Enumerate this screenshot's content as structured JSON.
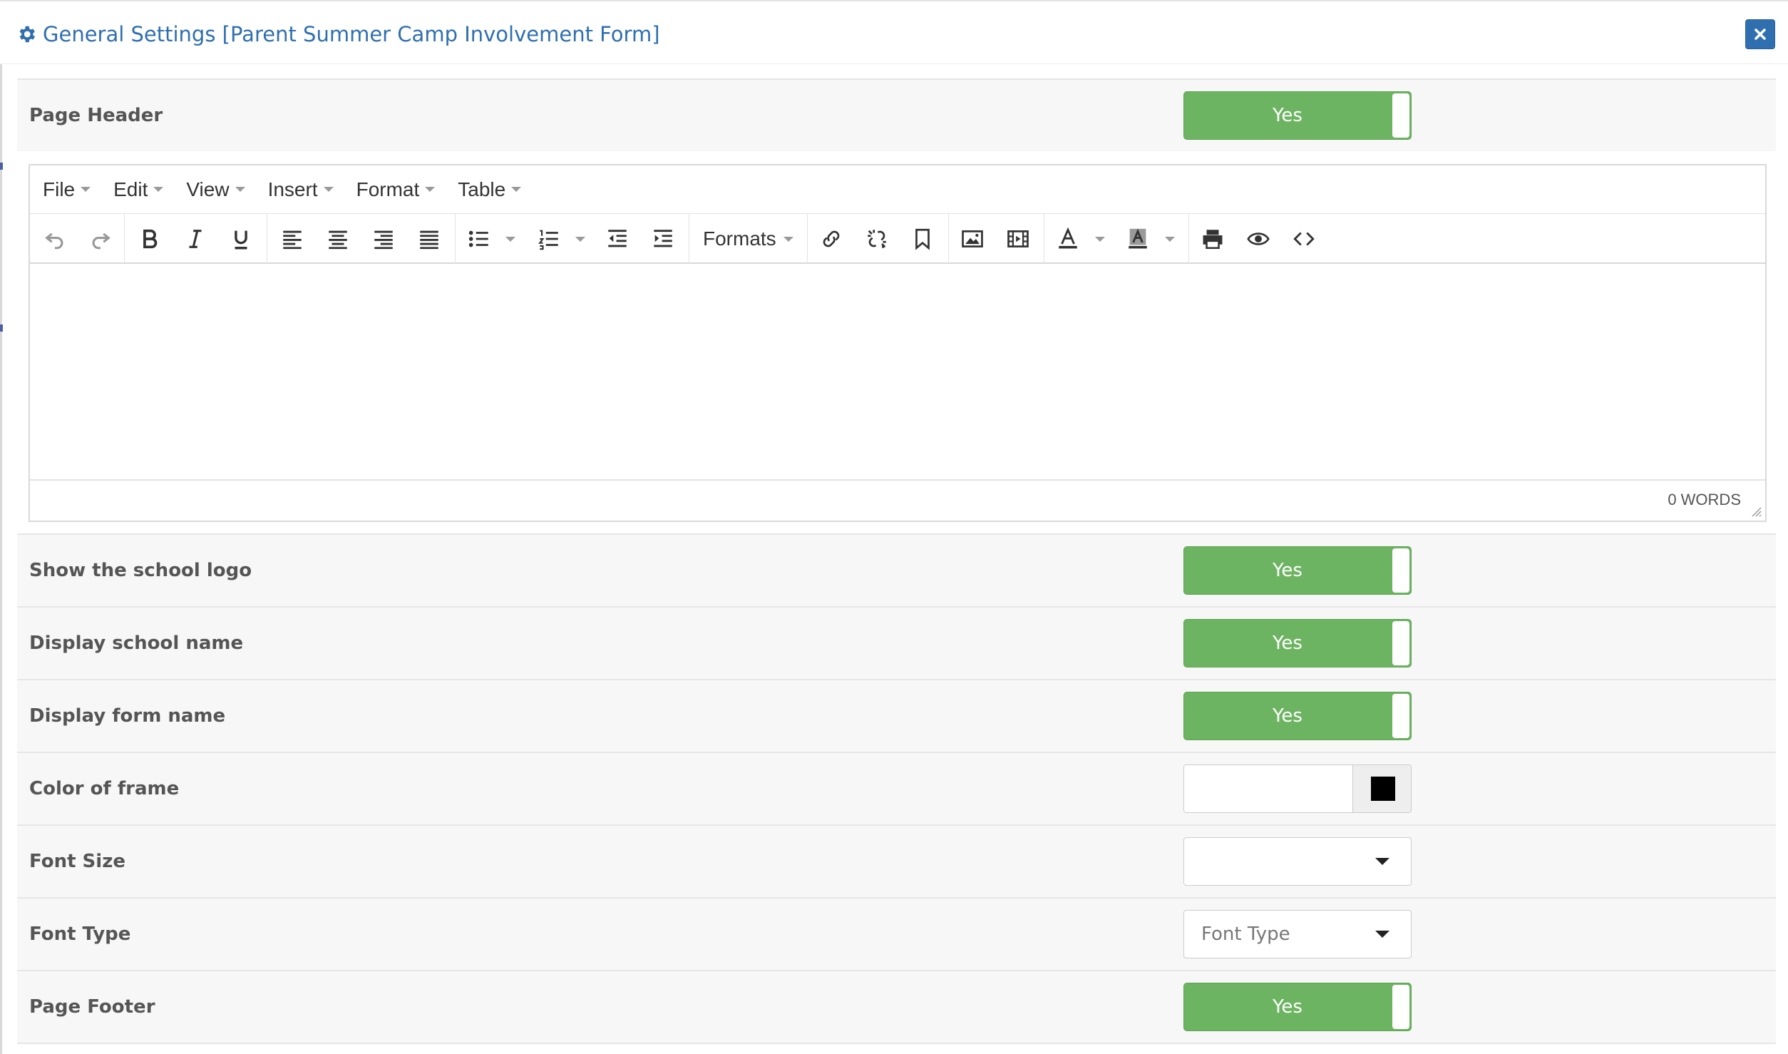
{
  "modal": {
    "title": "General Settings [Parent Summer Camp Involvement Form]",
    "title_icon": "gear-icon",
    "close_icon": "close-icon"
  },
  "editor": {
    "menus": [
      "File",
      "Edit",
      "View",
      "Insert",
      "Format",
      "Table"
    ],
    "formats_label": "Formats",
    "word_count": "0 WORDS"
  },
  "settings": {
    "page_header": {
      "label": "Page Header",
      "value": "Yes"
    },
    "show_logo": {
      "label": "Show the school logo",
      "value": "Yes"
    },
    "display_school_name": {
      "label": "Display school name",
      "value": "Yes"
    },
    "display_form_name": {
      "label": "Display form name",
      "value": "Yes"
    },
    "color_of_frame": {
      "label": "Color of frame",
      "value": "",
      "swatch_color": "#000000"
    },
    "font_size": {
      "label": "Font Size",
      "value": ""
    },
    "font_type": {
      "label": "Font Type",
      "placeholder": "Font Type"
    },
    "page_footer": {
      "label": "Page Footer",
      "value": "Yes"
    }
  },
  "colors": {
    "accent": "#2f6fb0",
    "toggle_on": "#6db462",
    "row_bg": "#f7f7f7"
  }
}
